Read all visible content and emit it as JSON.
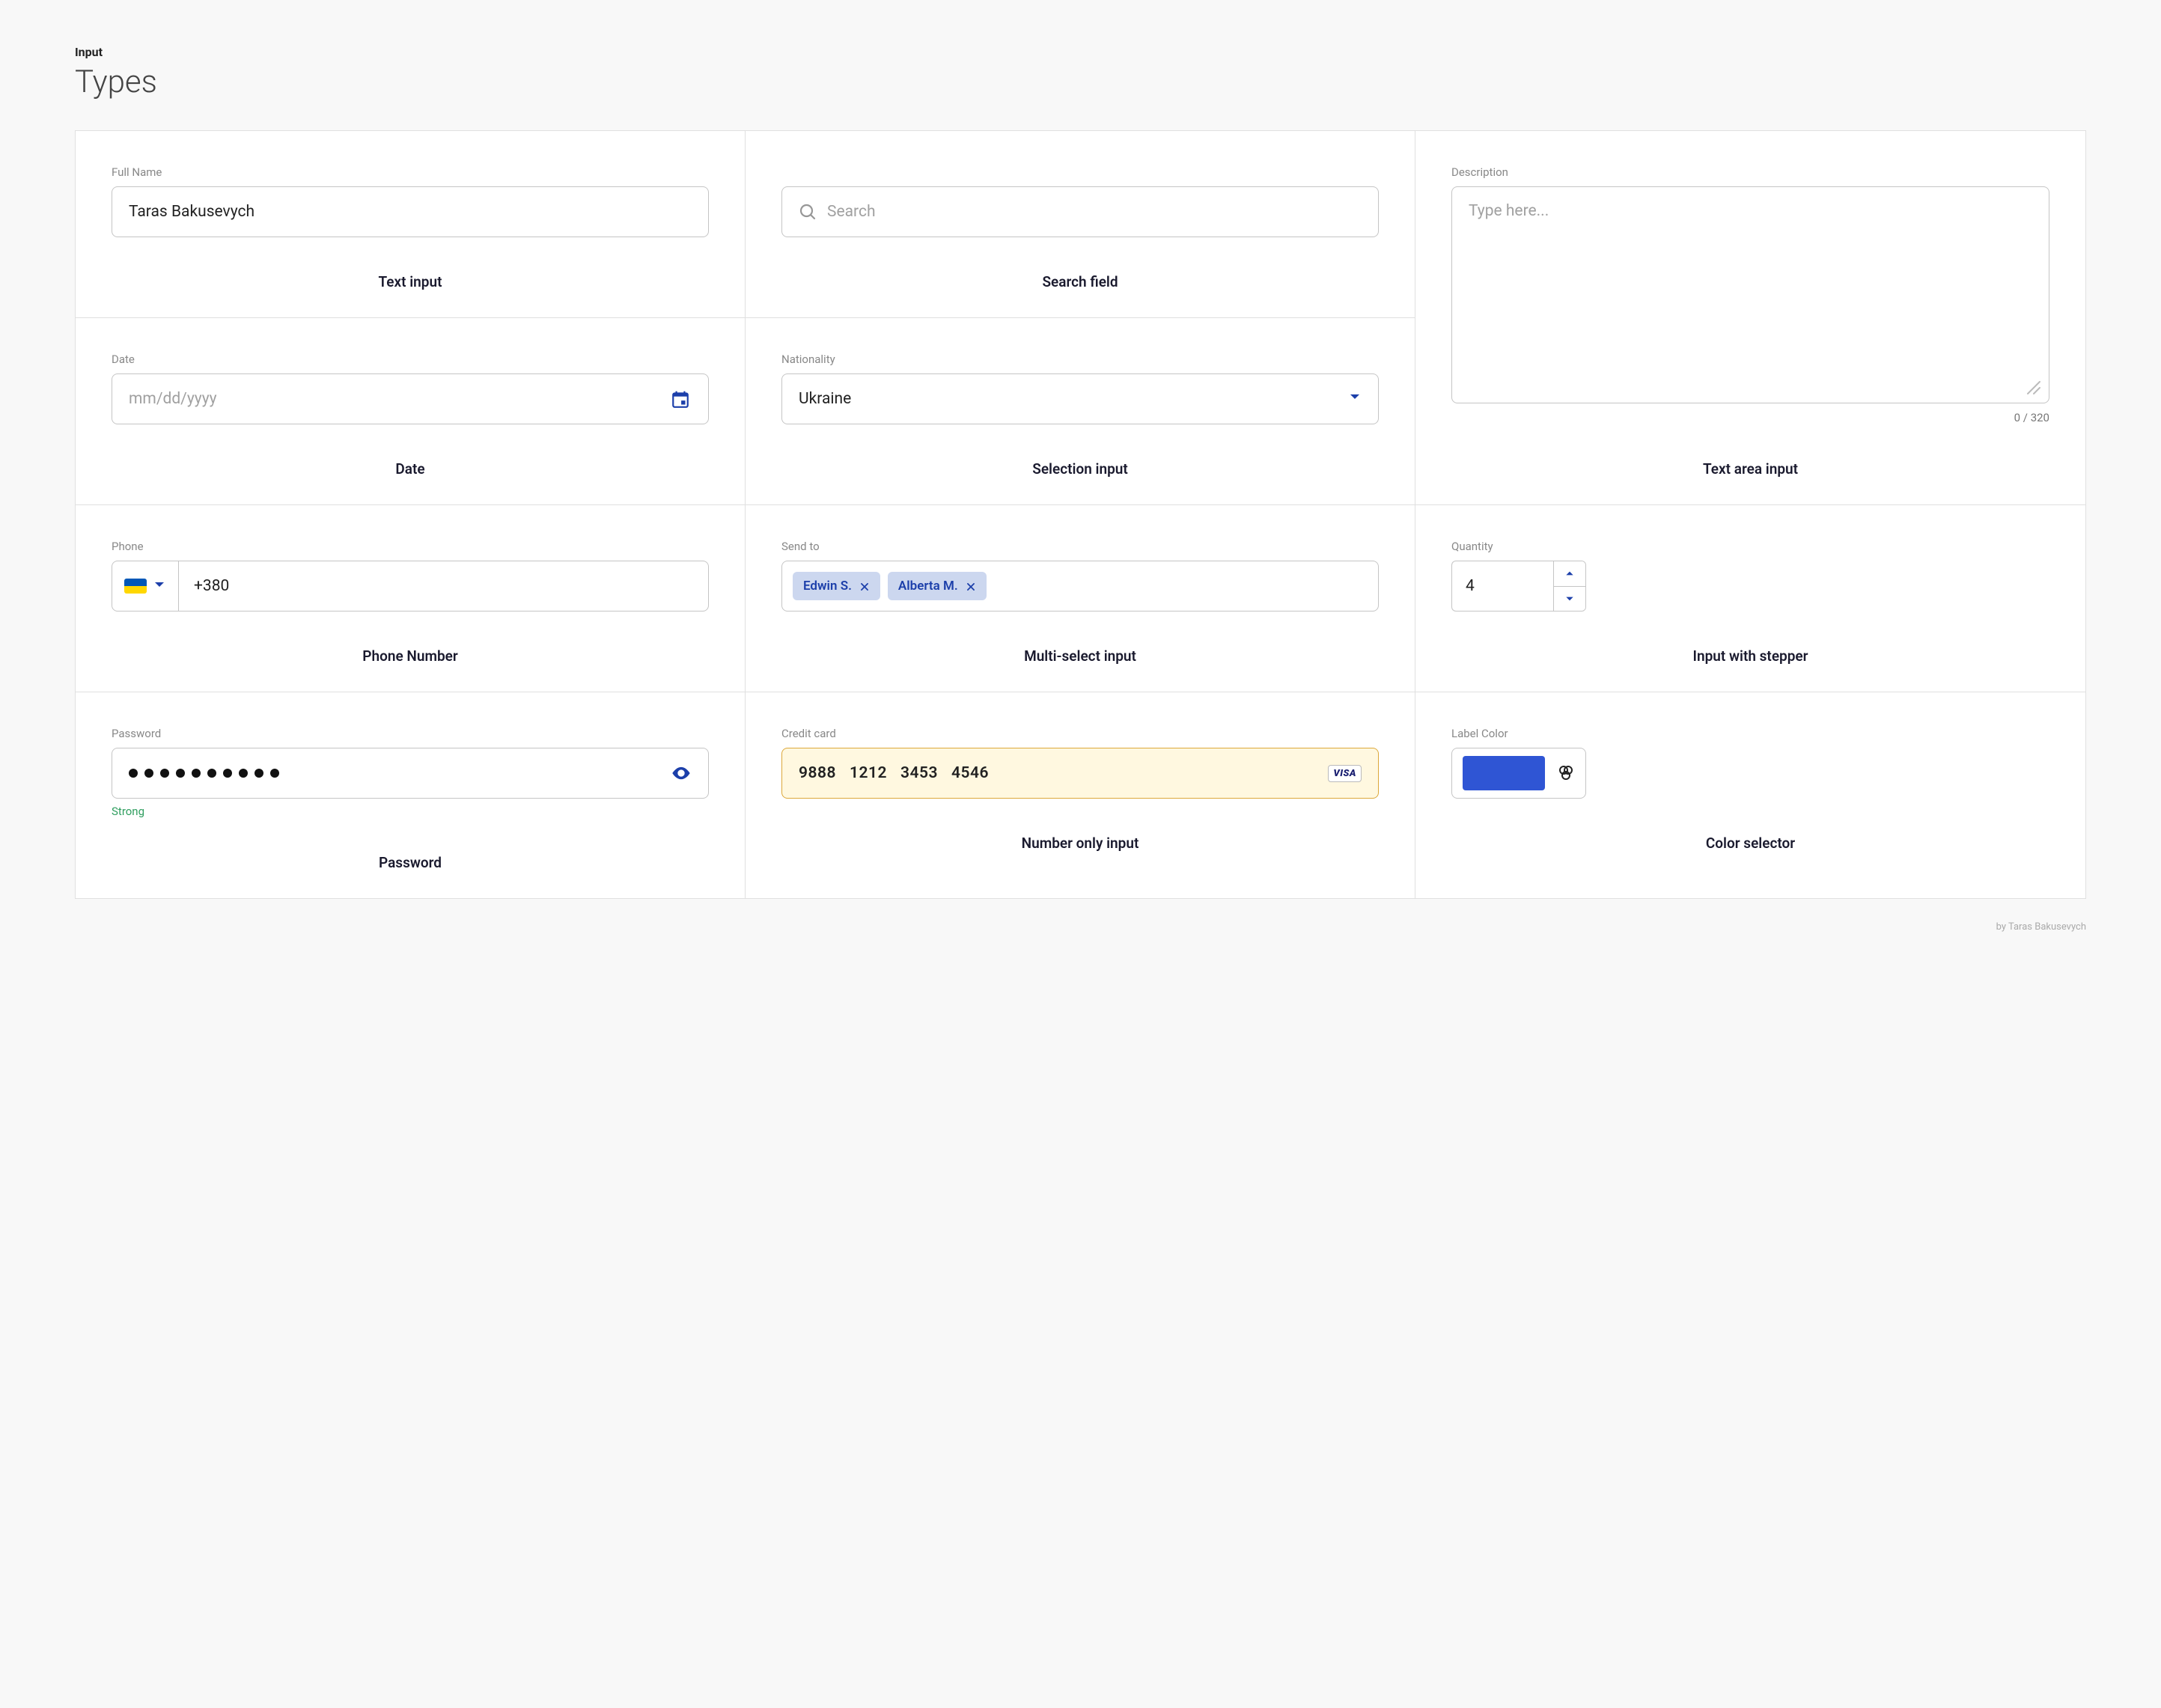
{
  "header": {
    "sup": "Input",
    "title": "Types"
  },
  "fullName": {
    "label": "Full Name",
    "value": "Taras Bakusevych",
    "caption": "Text input"
  },
  "search": {
    "placeholder": "Search",
    "caption": "Search field"
  },
  "description": {
    "label": "Description",
    "placeholder": "Type here...",
    "counter": "0 / 320",
    "caption": "Text area input"
  },
  "date": {
    "label": "Date",
    "placeholder": "mm/dd/yyyy",
    "caption": "Date"
  },
  "nationality": {
    "label": "Nationality",
    "value": "Ukraine",
    "caption": "Selection input"
  },
  "phone": {
    "label": "Phone",
    "value": "+380",
    "caption": "Phone Number"
  },
  "sendTo": {
    "label": "Send to",
    "chips": [
      "Edwin S.",
      "Alberta M."
    ],
    "caption": "Multi-select input"
  },
  "quantity": {
    "label": "Quantity",
    "value": "4",
    "caption": "Input with stepper"
  },
  "password": {
    "label": "Password",
    "dotCount": 10,
    "strength": "Strong",
    "caption": "Password"
  },
  "creditCard": {
    "label": "Credit card",
    "groups": [
      "9888",
      "1212",
      "3453",
      "4546"
    ],
    "brand": "VISA",
    "caption": "Number only input"
  },
  "labelColor": {
    "label": "Label Color",
    "color": "#2f55d4",
    "caption": "Color selector"
  },
  "credit": "by Taras Bakusevych"
}
